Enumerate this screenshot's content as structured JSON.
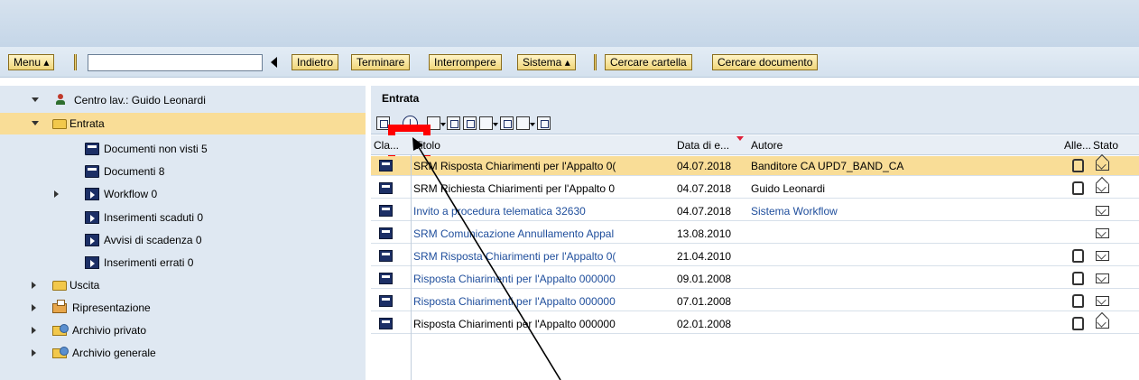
{
  "toolbar": {
    "menu": "Menu",
    "command_value": "",
    "back": "Indietro",
    "exit": "Terminare",
    "cancel": "Interrompere",
    "system": "Sistema",
    "search_folder": "Cercare cartella",
    "search_document": "Cercare documento"
  },
  "tree": {
    "root": "Centro lav.: Guido Leonardi",
    "inbox": "Entrata",
    "inbox_items": [
      "Documenti non visti 5",
      "Documenti 8",
      "Workflow 0",
      "Inserimenti scaduti 0",
      "Avvisi di scadenza 0",
      "Inserimenti errati 0"
    ],
    "outbox": "Uscita",
    "resubmission": "Ripresentazione",
    "private_archive": "Archivio privato",
    "general_archive": "Archivio generale"
  },
  "pane": {
    "title": "Entrata",
    "columns": {
      "class": "Cla...",
      "title": "Titolo",
      "date": "Data di e...",
      "author": "Autore",
      "attach": "Alle...",
      "status": "Stato"
    },
    "rows": [
      {
        "title": "SRM Risposta Chiarimenti per l'Appalto 0(",
        "date": "04.07.2018",
        "author": "Banditore CA UPD7_BAND_CA",
        "attach": true,
        "status": "read"
      },
      {
        "title": "SRM Richiesta Chiarimenti per l'Appalto 0",
        "date": "04.07.2018",
        "author": "Guido Leonardi",
        "attach": true,
        "status": "read"
      },
      {
        "title": "Invito a procedura telematica 32630",
        "date": "04.07.2018",
        "author": "Sistema Workflow",
        "attach": false,
        "status": "unread"
      },
      {
        "title": "SRM Comunicazione Annullamento Appal",
        "date": "13.08.2010",
        "author": "",
        "attach": false,
        "status": "unread"
      },
      {
        "title": "SRM Risposta Chiarimenti per l'Appalto 0(",
        "date": "21.04.2010",
        "author": "",
        "attach": true,
        "status": "unread"
      },
      {
        "title": "Risposta Chiarimenti per l'Appalto 000000",
        "date": "09.01.2008",
        "author": "",
        "attach": true,
        "status": "unread"
      },
      {
        "title": "Risposta Chiarimenti per l'Appalto 000000",
        "date": "07.01.2008",
        "author": "",
        "attach": true,
        "status": "unread"
      },
      {
        "title": "Risposta Chiarimenti per l'Appalto 000000",
        "date": "02.01.2008",
        "author": "",
        "attach": true,
        "status": "read"
      }
    ]
  },
  "colors": {
    "selection": "#f9dd97",
    "highlight_box": "#ff0000",
    "link": "#1f4e9c",
    "button_face": "#f0d57a"
  }
}
